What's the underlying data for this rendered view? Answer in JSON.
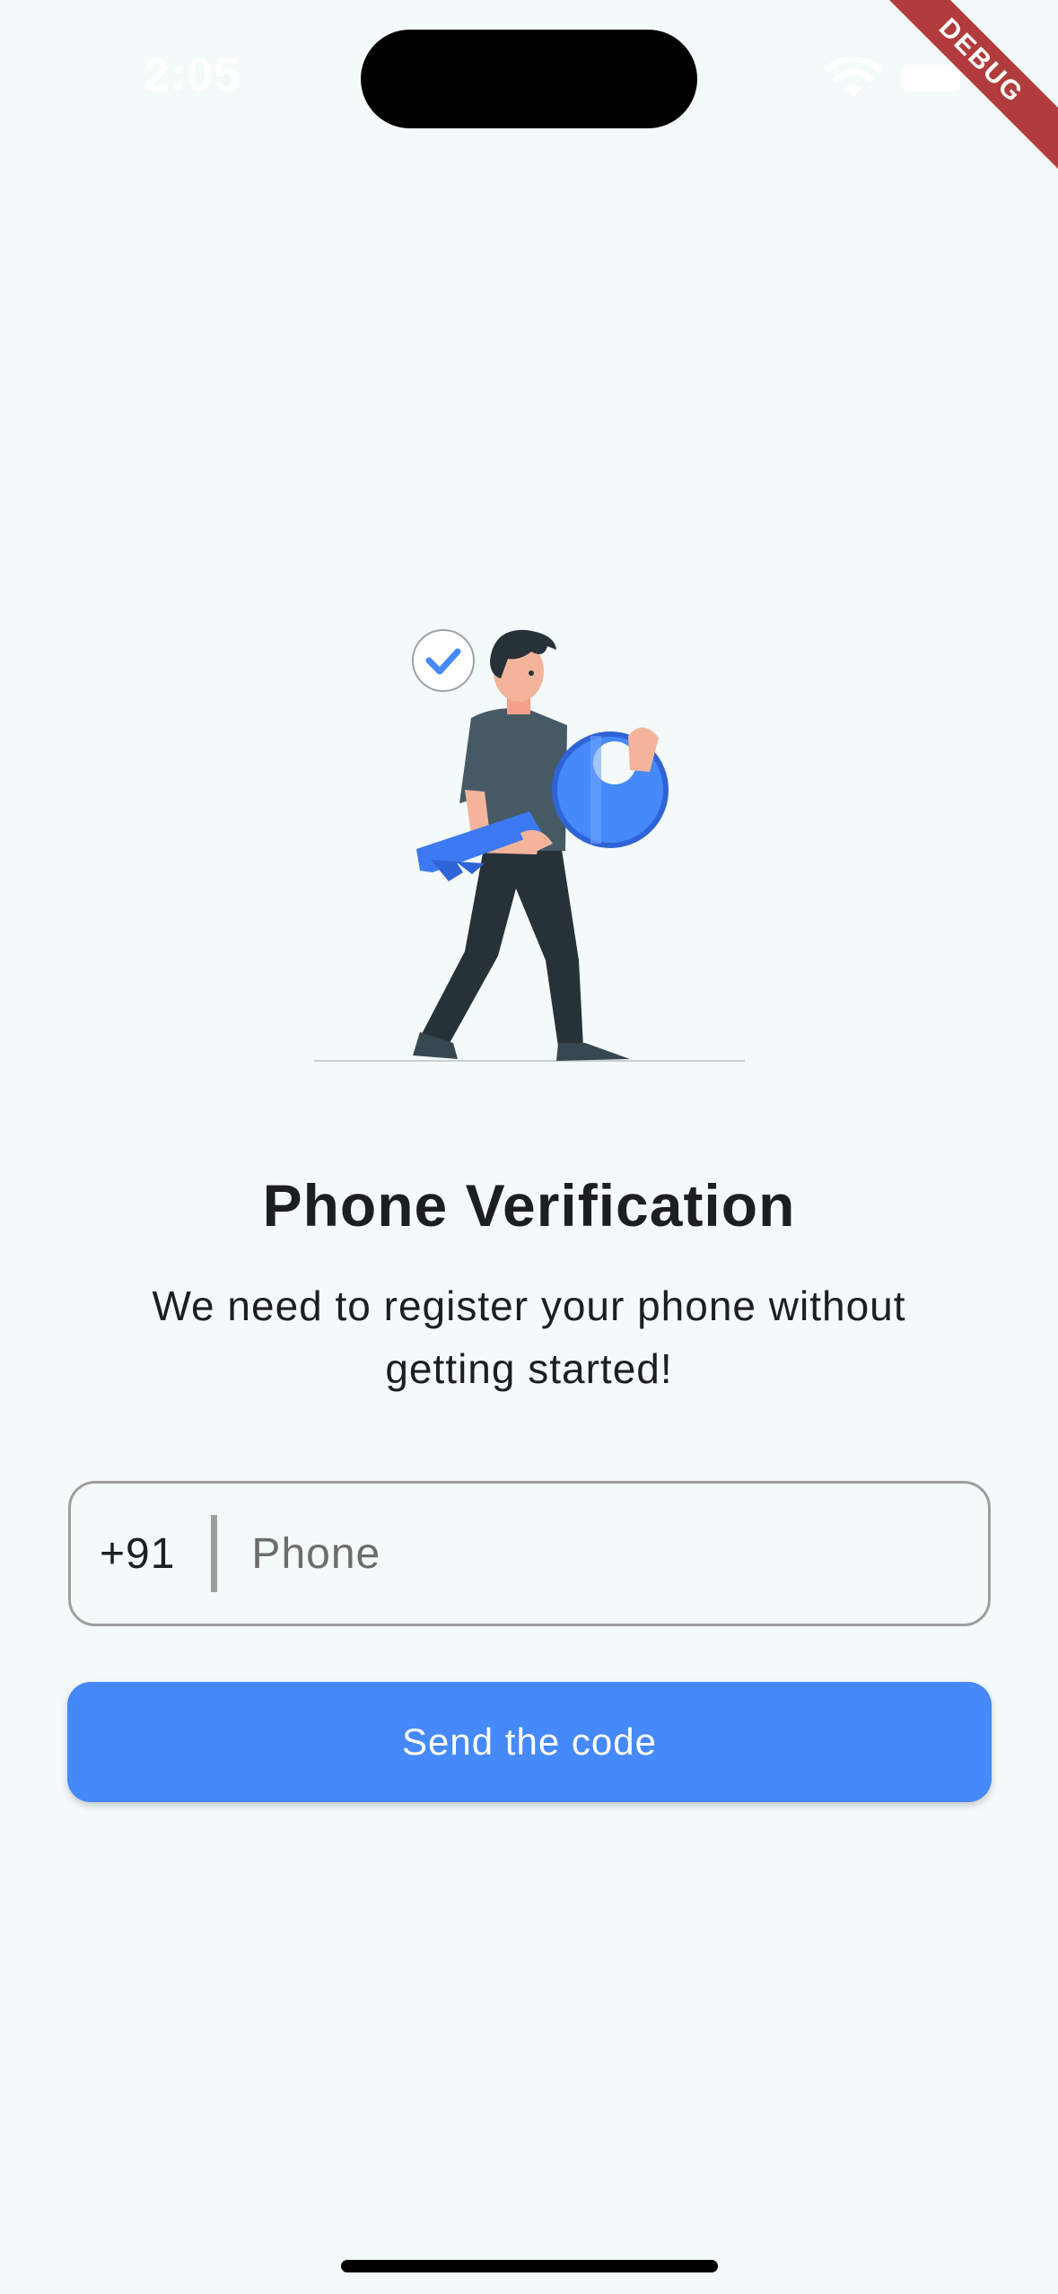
{
  "status_bar": {
    "time": "2:05",
    "icons": [
      "wifi-icon",
      "battery-icon"
    ]
  },
  "debug_banner": {
    "label": "DEBUG",
    "color": "#b23c3c"
  },
  "illustration": {
    "name": "person-carrying-key-illustration",
    "accent_color": "#4589fb",
    "icons": [
      "checkmark-icon",
      "key-icon"
    ]
  },
  "verification": {
    "title": "Phone Verification",
    "subtitle": "We need to register your phone without getting started!"
  },
  "phone_form": {
    "country_code": "+91",
    "phone_value": "",
    "phone_placeholder": "Phone"
  },
  "actions": {
    "send_label": "Send the code",
    "button_color": "#4589fb"
  },
  "theme": {
    "background": "#f4f9f9",
    "text": "#1c1f21"
  }
}
